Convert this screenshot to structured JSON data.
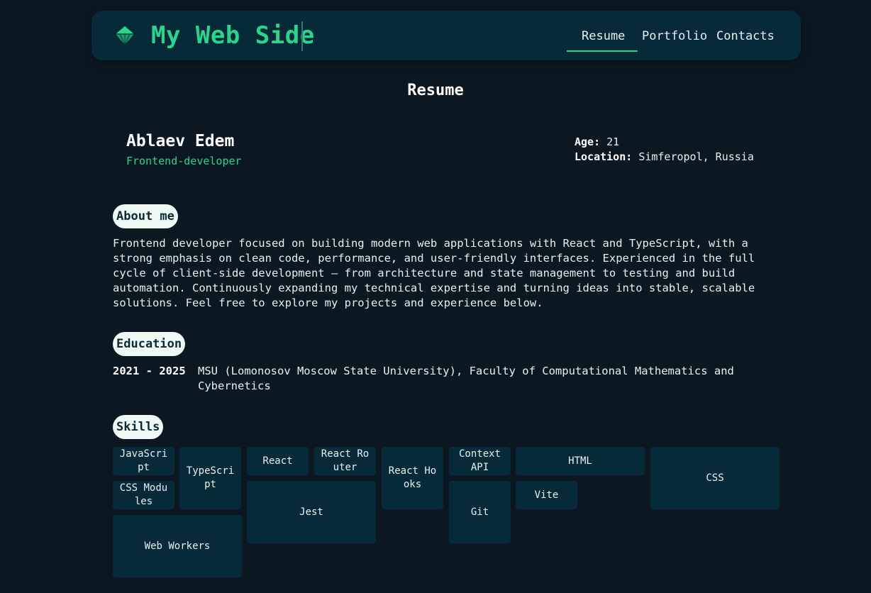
{
  "header": {
    "logo_text": "My Web Side",
    "nav": [
      "Resume",
      "Portfolio",
      "Contacts"
    ]
  },
  "page_title": "Resume",
  "profile": {
    "name": "Ablaev Edem",
    "role": "Frontend-developer",
    "age_label": "Age:",
    "age": "21",
    "location_label": "Location:",
    "location": "Simferopol, Russia"
  },
  "about": {
    "heading": "About me",
    "text": "Frontend developer focused on building modern web applications with React and TypeScript, with a strong emphasis on clean code, performance, and user-friendly interfaces. Experienced in the full cycle of client-side development — from architecture and state management to testing and build automation. Continuously expanding my technical expertise and turning ideas into stable, scalable solutions. Feel free to explore my projects and experience below."
  },
  "education": {
    "heading": "Education",
    "years": "2021 - 2025",
    "text": "MSU (Lomonosov Moscow State University), Faculty of Computational Mathematics and Cybernetics"
  },
  "skills": {
    "heading": "Skills",
    "items": [
      "JavaScript",
      "TypeScript",
      "React",
      "React Router",
      "React Hooks",
      "Context API",
      "HTML",
      "CSS",
      "CSS Modules",
      "Jest",
      "Vite",
      "Git",
      "Web Workers"
    ]
  },
  "colors": {
    "accent": "#2bd48c",
    "background": "#0c1821",
    "card": "#072a38"
  }
}
